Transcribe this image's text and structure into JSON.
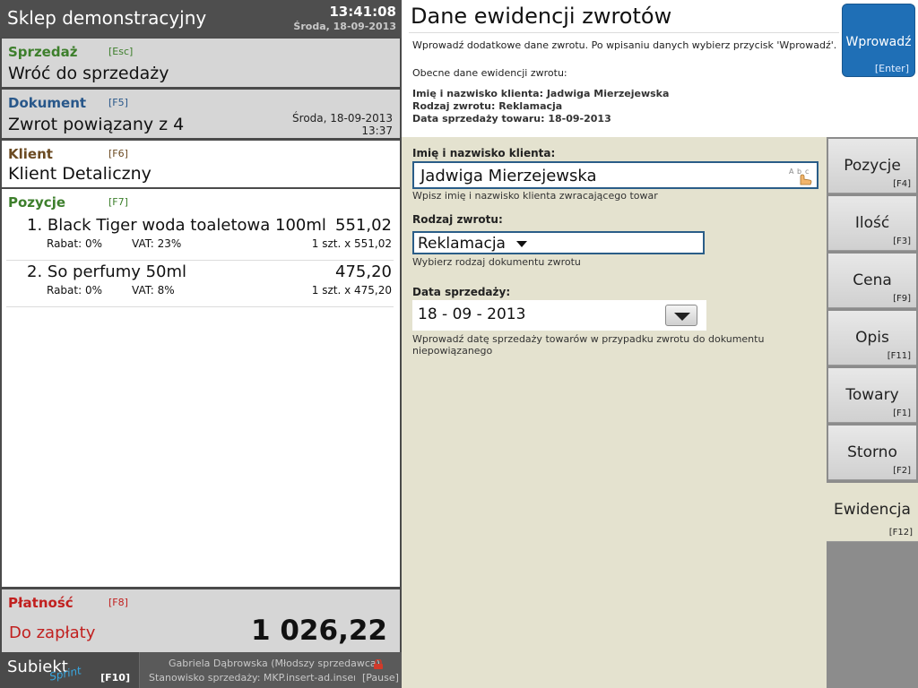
{
  "left": {
    "store_name": "Sklep demonstracyjny",
    "time": "13:41:08",
    "date": "Środa, 18-09-2013",
    "sprzedaz": {
      "caption": "Sprzedaż",
      "key": "[Esc]",
      "value": "Wróć do sprzedaży"
    },
    "dokument": {
      "caption": "Dokument",
      "key": "[F5]",
      "value": "Zwrot powiązany z 4",
      "date": "Środa, 18-09-2013",
      "time": "13:37"
    },
    "klient": {
      "caption": "Klient",
      "key": "[F6]",
      "value": "Klient Detaliczny"
    },
    "pozycje": {
      "caption": "Pozycje",
      "key": "[F7]",
      "items": [
        {
          "name": "1. Black Tiger woda toaletowa 100ml",
          "price": "551,02",
          "rabat": "Rabat: 0%",
          "vat": "VAT: 23%",
          "qty": "1 szt. x 551,02"
        },
        {
          "name": "2. So perfumy 50ml",
          "price": "475,20",
          "rabat": "Rabat: 0%",
          "vat": "VAT: 8%",
          "qty": "1 szt. x 475,20"
        }
      ]
    },
    "platnosc": {
      "caption": "Płatność",
      "key": "[F8]",
      "due_label": "Do zapłaty",
      "total": "1 026,22"
    },
    "footer": {
      "logo_main": "Subiekt",
      "logo_sub": "Sprint",
      "logo_key": "[F10]",
      "user": "Gabriela Dąbrowska (Młodszy sprzedawca)",
      "station": "Stanowisko sprzedaży: MKP.insert-ad.insert....",
      "pause": "[Pause]"
    }
  },
  "right": {
    "title": "Dane ewidencji zwrotów",
    "instruction": "Wprowadź dodatkowe dane zwrotu. Po wpisaniu danych wybierz przycisk 'Wprowadź'.",
    "current_label": "Obecne dane ewidencji zwrotu:",
    "info_lines": [
      "Imię i nazwisko klienta: Jadwiga Mierzejewska",
      "Rodzaj zwrotu: Reklamacja",
      "Data sprzedaży towaru: 18-09-2013"
    ],
    "enter_button": {
      "label": "Wprowadź",
      "key": "[Enter]"
    },
    "form": {
      "name_label": "Imię i nazwisko klienta:",
      "name_value": "Jadwiga Mierzejewska",
      "name_hint": "Wpisz imię i nazwisko klienta zwracającego towar",
      "type_label": "Rodzaj zwrotu:",
      "type_value": "Reklamacja",
      "type_hint": "Wybierz rodzaj dokumentu zwrotu",
      "date_label": "Data sprzedaży:",
      "date_value": "18 - 09 - 2013",
      "date_hint": "Wprowadź datę sprzedaży towarów w przypadku zwrotu do dokumentu niepowiązanego"
    },
    "tabs": [
      {
        "name": "Pozycje",
        "key": "[F4]"
      },
      {
        "name": "Ilość",
        "key": "[F3]"
      },
      {
        "name": "Cena",
        "key": "[F9]"
      },
      {
        "name": "Opis",
        "key": "[F11]"
      },
      {
        "name": "Towary",
        "key": "[F1]"
      },
      {
        "name": "Storno",
        "key": "[F2]"
      },
      {
        "name": "Ewidencja",
        "key": "[F12]"
      }
    ]
  },
  "colors": {
    "green": "#3d7f2c",
    "blue": "#28578a",
    "brown": "#6b4a21",
    "red": "#c1201f",
    "enter_button": "#1f6fb6",
    "form_bg": "#e4e2cf"
  }
}
